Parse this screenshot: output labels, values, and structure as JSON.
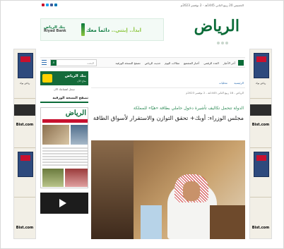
{
  "topbar": {
    "date": "الخميس 20 ربيع الثاني 1445هـ - 2 نوفمبر 2023م",
    "social_colors": [
      "#c8102e",
      "#1da1f2",
      "#3b5998",
      "#0077b5"
    ]
  },
  "header": {
    "logo": "الرياض",
    "banner": {
      "bank_ar": "بنك الرياض",
      "bank_en": "Riyad Bank",
      "slogan_a": "ابدأ.. إبتني..",
      "slogan_b": "دائماً معك"
    }
  },
  "nav": {
    "items": [
      "آخر الأخبار",
      "العدد الرقمي",
      "أخبار المجتمع",
      "مقالات اليوم",
      "حديث الرياض",
      "تصفح النسخة الورقية"
    ],
    "search_placeholder": "البحث",
    "search_icon": "search-icon",
    "menu_icon": "menu-icon"
  },
  "breadcrumb": [
    "الرئيسية",
    "محليات"
  ],
  "article": {
    "meta": "الرياض - 18 ربيع الثاني 1445هـ - 2 نوفمبر 2023م",
    "subtitle": "الدولة تتحمل تكاليف تأشيرة دخول حاملي بطاقة «هيّا» للمملكة",
    "title": "مجلس الوزراء: أوبك+ تحقق التوازن والاستقرار لأسواق الطاقة"
  },
  "sidebar": {
    "ad_title": "بنك الرياض",
    "ad_line": "متاح الآن",
    "ad_caption": "سجل اهتمامك الآن",
    "print_heading": "تصفح النسخة الورقية",
    "paper_mast": "الرياض"
  },
  "side_ads": {
    "left": [
      "رياض بوك",
      "Bist.com"
    ],
    "right": [
      "رياض بوك",
      "Bist.com"
    ]
  },
  "colors": {
    "brand_green": "#0b6b38",
    "link_blue": "#2f6fb3",
    "subtitle_green": "#2e8b57"
  }
}
